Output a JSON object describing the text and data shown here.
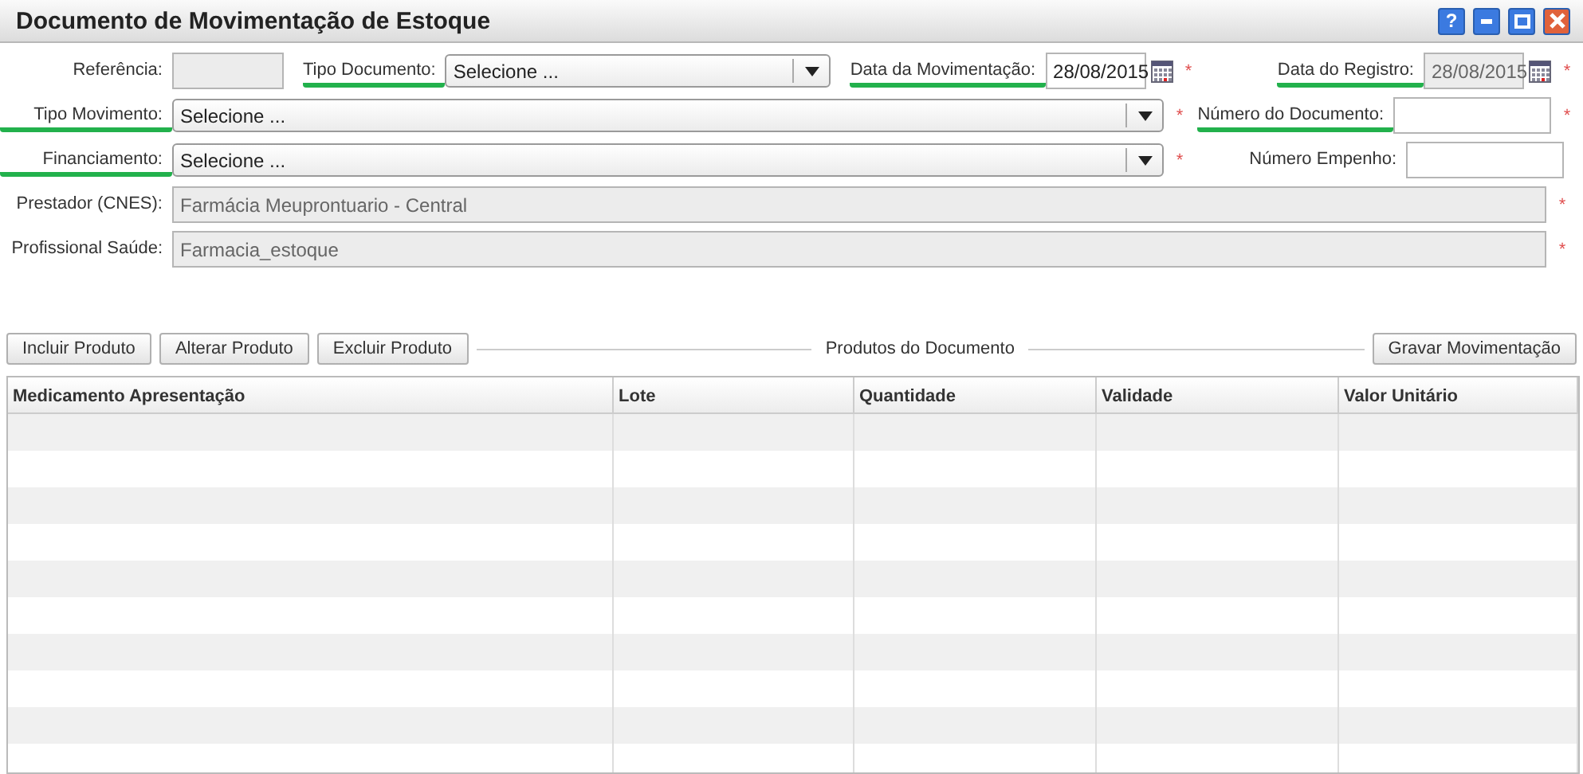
{
  "window": {
    "title": "Documento de Movimentação de Estoque",
    "buttons": [
      {
        "kind": "help",
        "label": "?"
      },
      {
        "kind": "minimize"
      },
      {
        "kind": "maximize"
      },
      {
        "kind": "close"
      }
    ]
  },
  "form": {
    "required_mark": "*",
    "rows": [
      {
        "fields": [
          {
            "label": "Referência:",
            "kind": "text",
            "disabled": true,
            "highlighted": false,
            "required": false
          },
          {
            "label": "Tipo Documento:",
            "kind": "select",
            "value": "Selecione ...",
            "highlighted": true,
            "required": false
          },
          {
            "label": "Data da Movimentação:",
            "kind": "date",
            "value": "28/08/2015",
            "disabled": false,
            "highlighted": true,
            "required": true
          }
        ],
        "side": {
          "label": "Data do Registro:",
          "kind": "date",
          "value": "28/08/2015",
          "disabled": true,
          "highlighted": true,
          "required": true
        }
      },
      {
        "fields": [
          {
            "label": "Tipo Movimento:",
            "kind": "select",
            "value": "Selecione ...",
            "highlighted": true,
            "required": true
          }
        ],
        "side": {
          "label": "Número do Documento:",
          "kind": "text",
          "disabled": false,
          "highlighted": true,
          "required": true
        }
      },
      {
        "fields": [
          {
            "label": "Financiamento:",
            "kind": "select",
            "value": "Selecione ...",
            "highlighted": true,
            "required": true
          }
        ],
        "side": {
          "label": "Número Empenho:",
          "kind": "text",
          "disabled": false,
          "highlighted": false,
          "required": false
        }
      },
      {
        "fields": [
          {
            "label": "Prestador (CNES):",
            "kind": "text",
            "value": "Farmácia Meuprontuario - Central",
            "disabled": true,
            "highlighted": false,
            "required": true
          }
        ]
      },
      {
        "fields": [
          {
            "label": "Profissional Saúde:",
            "kind": "text",
            "value": "Farmacia_estoque",
            "disabled": true,
            "highlighted": false,
            "required": true
          }
        ]
      }
    ]
  },
  "toolbar": {
    "buttons": [
      "Incluir Produto",
      "Alterar Produto",
      "Excluir Produto"
    ],
    "legend": "Produtos do Documento",
    "save": "Gravar Movimentação"
  },
  "table": {
    "columns": [
      "Medicamento Apresentação",
      "Lote",
      "Quantidade",
      "Validade",
      "Valor Unitário"
    ]
  }
}
